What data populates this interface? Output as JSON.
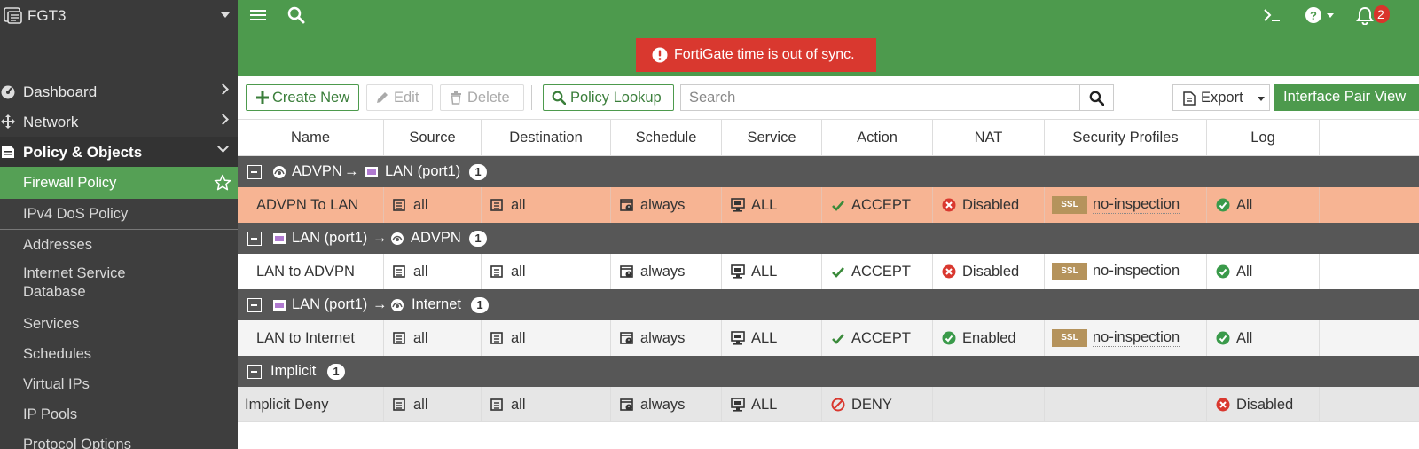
{
  "app": {
    "device_name": "FGT3"
  },
  "nav": {
    "items": [
      {
        "label": "Dashboard",
        "icon": "dashboard-icon"
      },
      {
        "label": "Network",
        "icon": "network-icon"
      },
      {
        "label": "Policy & Objects",
        "icon": "policy-icon"
      }
    ],
    "sub_items": [
      {
        "label": "Firewall Policy"
      },
      {
        "label": "IPv4 DoS Policy"
      },
      {
        "label": "Addresses"
      },
      {
        "label": "Internet Service Database"
      },
      {
        "label": "Services"
      },
      {
        "label": "Schedules"
      },
      {
        "label": "Virtual IPs"
      },
      {
        "label": "IP Pools"
      },
      {
        "label": "Protocol Options"
      }
    ]
  },
  "topbar": {
    "notification_count": "2",
    "alert": "FortiGate time is out of sync."
  },
  "toolbar": {
    "create_new": "Create New",
    "edit": "Edit",
    "delete": "Delete",
    "policy_lookup": "Policy Lookup",
    "search_placeholder": "Search",
    "export": "Export",
    "interface_pair_view": "Interface Pair View"
  },
  "table": {
    "columns": [
      "Name",
      "Source",
      "Destination",
      "Schedule",
      "Service",
      "Action",
      "NAT",
      "Security Profiles",
      "Log"
    ],
    "groups": [
      {
        "from": "ADVPN",
        "to": "LAN (port1)",
        "count": "1",
        "rows": [
          {
            "name": "ADVPN To LAN",
            "source": "all",
            "destination": "all",
            "schedule": "always",
            "service": "ALL",
            "action": "ACCEPT",
            "nat": "Disabled",
            "profile_badge": "SSL",
            "profile": "no-inspection",
            "log": "All"
          }
        ]
      },
      {
        "from": "LAN (port1)",
        "to": "ADVPN",
        "count": "1",
        "rows": [
          {
            "name": "LAN to ADVPN",
            "source": "all",
            "destination": "all",
            "schedule": "always",
            "service": "ALL",
            "action": "ACCEPT",
            "nat": "Disabled",
            "profile_badge": "SSL",
            "profile": "no-inspection",
            "log": "All"
          }
        ]
      },
      {
        "from": "LAN (port1)",
        "to": "Internet",
        "count": "1",
        "rows": [
          {
            "name": "LAN to Internet",
            "source": "all",
            "destination": "all",
            "schedule": "always",
            "service": "ALL",
            "action": "ACCEPT",
            "nat": "Enabled",
            "profile_badge": "SSL",
            "profile": "no-inspection",
            "log": "All"
          }
        ]
      },
      {
        "label": "Implicit",
        "count": "1",
        "rows": [
          {
            "name": "Implicit Deny",
            "source": "all",
            "destination": "all",
            "schedule": "always",
            "service": "ALL",
            "action": "DENY",
            "log": "Disabled"
          }
        ]
      }
    ]
  },
  "colors": {
    "brand_green": "#4d9a4d",
    "sidebar_bg": "#3a3a3a",
    "alert_red": "#d9382f",
    "selected_row": "#f7b493",
    "group_header": "#575757"
  }
}
